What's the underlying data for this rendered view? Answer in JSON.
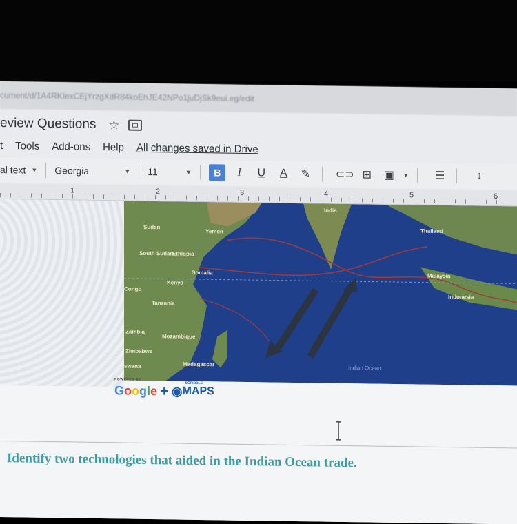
{
  "browser": {
    "url": "cument/d/1A4RKIexCEjYrzgXdR84koEhJE42NPo1juDjSk9eui.eg/edit"
  },
  "document": {
    "title": "eview Questions",
    "saved_status": "All changes saved in Drive"
  },
  "menu": {
    "items": [
      "t",
      "Tools",
      "Add-ons",
      "Help"
    ]
  },
  "toolbar": {
    "style": "al text",
    "font": "Georgia",
    "size": "11",
    "bold": "B",
    "italic": "I",
    "underline": "U",
    "text_color": "A"
  },
  "ruler": {
    "numbers": [
      "1",
      "2",
      "3",
      "4",
      "5",
      "6"
    ]
  },
  "map": {
    "labels": [
      "Sudan",
      "Yemen",
      "South Sudan",
      "Ethiopia",
      "Somalia",
      "Kenya",
      "Congo",
      "Tanzania",
      "Zambia",
      "Mozambique",
      "Zimbabwe",
      "Madagascar",
      "swana",
      "India",
      "Thailand",
      "Indonesia",
      "Malaysia",
      "Indian Ocean"
    ],
    "colors": {
      "ocean": "#1f3f8a",
      "land": "#6f8a4e",
      "route": "#a33a3a",
      "arrow": "#2b3440"
    }
  },
  "credit": {
    "powered_by": "POWERED BY",
    "google": [
      "G",
      "o",
      "o",
      "g",
      "l",
      "e"
    ],
    "plus": "+",
    "scribble": "SCRIBBLE",
    "maps": "MAPS"
  },
  "body": {
    "question": "Identify two technologies that aided in the Indian Ocean trade."
  }
}
